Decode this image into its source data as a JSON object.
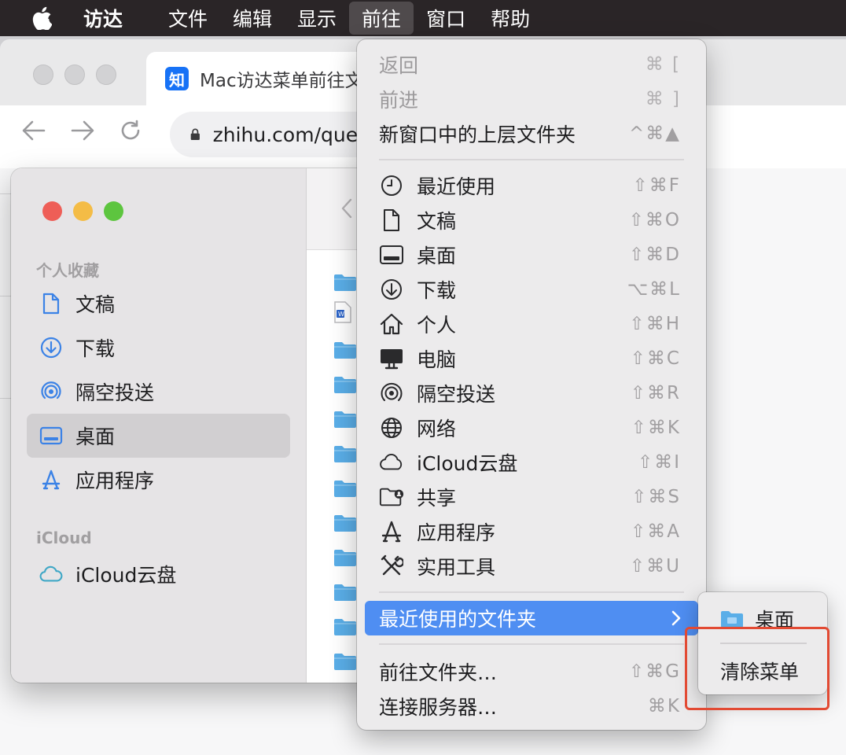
{
  "menubar": {
    "items": [
      {
        "label": "访达",
        "bold": true
      },
      {
        "label": "文件"
      },
      {
        "label": "编辑"
      },
      {
        "label": "显示"
      },
      {
        "label": "前往",
        "active": true
      },
      {
        "label": "窗口"
      },
      {
        "label": "帮助"
      }
    ]
  },
  "browser": {
    "tab_icon": "知",
    "tab_title": "Mac访达菜单前往文件夹",
    "url": "zhihu.com/question"
  },
  "finder": {
    "section_favorites": "个人收藏",
    "section_icloud": "iCloud",
    "items": [
      {
        "label": "文稿",
        "icon": "doc-icon"
      },
      {
        "label": "下载",
        "icon": "download-icon"
      },
      {
        "label": "隔空投送",
        "icon": "airdrop-icon"
      },
      {
        "label": "桌面",
        "icon": "desktop-icon",
        "selected": true
      },
      {
        "label": "应用程序",
        "icon": "applications-icon"
      }
    ],
    "icloud_item": {
      "label": "iCloud云盘",
      "icon": "icloud-icon"
    }
  },
  "go_menu": {
    "back": {
      "label": "返回",
      "shortcut": "⌘ [",
      "disabled": true
    },
    "forward": {
      "label": "前进",
      "shortcut": "⌘ ]",
      "disabled": true
    },
    "enclosing": {
      "label": "新窗口中的上层文件夹",
      "shortcut": "^⌘▲"
    },
    "places": [
      {
        "label": "最近使用",
        "shortcut": "⇧⌘F",
        "icon": "clock-icon"
      },
      {
        "label": "文稿",
        "shortcut": "⇧⌘O",
        "icon": "doc-icon"
      },
      {
        "label": "桌面",
        "shortcut": "⇧⌘D",
        "icon": "desktop-icon"
      },
      {
        "label": "下载",
        "shortcut": "⌥⌘L",
        "icon": "download-icon"
      },
      {
        "label": "个人",
        "shortcut": "⇧⌘H",
        "icon": "home-icon"
      },
      {
        "label": "电脑",
        "shortcut": "⇧⌘C",
        "icon": "computer-icon"
      },
      {
        "label": "隔空投送",
        "shortcut": "⇧⌘R",
        "icon": "airdrop-icon"
      },
      {
        "label": "网络",
        "shortcut": "⇧⌘K",
        "icon": "network-icon"
      },
      {
        "label": "iCloud云盘",
        "shortcut": "⇧⌘I",
        "icon": "icloud-icon"
      },
      {
        "label": "共享",
        "shortcut": "⇧⌘S",
        "icon": "shared-folder-icon"
      },
      {
        "label": "应用程序",
        "shortcut": "⇧⌘A",
        "icon": "applications-icon"
      },
      {
        "label": "实用工具",
        "shortcut": "⇧⌘U",
        "icon": "utilities-icon"
      }
    ],
    "recent_folders": {
      "label": "最近使用的文件夹",
      "arrow": "›"
    },
    "goto_folder": {
      "label": "前往文件夹…",
      "shortcut": "⇧⌘G"
    },
    "connect_server": {
      "label": "连接服务器…",
      "shortcut": "⌘K"
    }
  },
  "submenu": {
    "desktop": "桌面",
    "clear": "清除菜单"
  },
  "colors": {
    "highlight": "#4f8ef2",
    "annotation_box": "#e24a33",
    "traffic_red": "#ee5e57",
    "traffic_yellow": "#f4bc46",
    "traffic_green": "#5dc53f",
    "folder_blue": "#5aaee8"
  }
}
